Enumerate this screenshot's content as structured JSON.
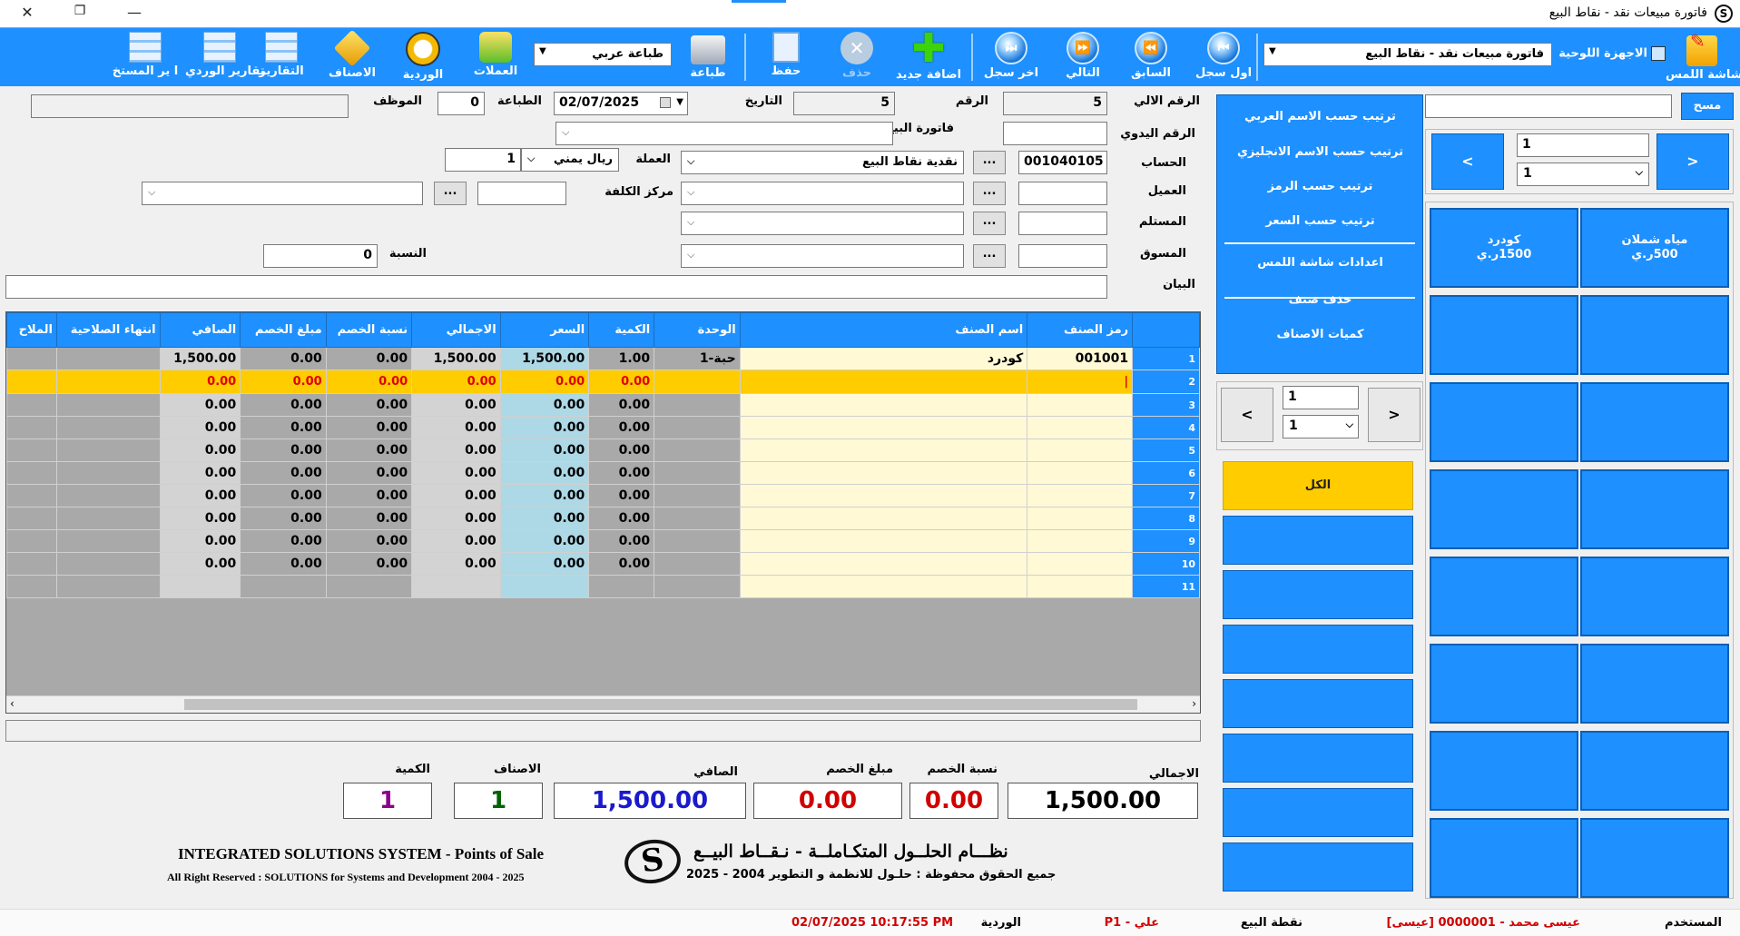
{
  "window": {
    "title": "فاتورة مبيعات نقد - نقاط البيع"
  },
  "toolbar": {
    "buttons": [
      {
        "label": "شاشة اللمس",
        "icon": "touch-screen-icon"
      },
      {
        "label": "اول سجل",
        "icon": "first-record-icon"
      },
      {
        "label": "السابق",
        "icon": "previous-icon"
      },
      {
        "label": "التالي",
        "icon": "next-icon"
      },
      {
        "label": "اخر سجل",
        "icon": "last-record-icon"
      },
      {
        "label": "اضافة جديد",
        "icon": "add-icon"
      },
      {
        "label": "حذف",
        "icon": "delete-icon"
      },
      {
        "label": "حفظ",
        "icon": "save-icon"
      },
      {
        "label": "طباعة",
        "icon": "print-icon"
      },
      {
        "label": "العملات",
        "icon": "currencies-icon"
      },
      {
        "label": "الوردية",
        "icon": "shift-icon"
      },
      {
        "label": "الاصناف",
        "icon": "items-icon"
      },
      {
        "label": "التقارير",
        "icon": "reports-icon"
      },
      {
        "label": "تقارير الوردي",
        "icon": "shift-reports-icon"
      },
      {
        "label": "ا ير المستخ",
        "icon": "user-reports-icon"
      }
    ],
    "tablet_label": "الاجهزة اللوحية",
    "invoice_type": "فاتورة مبيعات نقد - نقاط البيع",
    "print_mode": "طباعة عربي"
  },
  "header": {
    "auto_number_label": "الرقم الالي",
    "auto_number": "5",
    "number_label": "الرقم",
    "number": "5",
    "date_label": "التاريخ",
    "date": "02/07/2025",
    "print_label": "الطباعة",
    "print_count": "0",
    "employee_label": "الموظف",
    "employee": "",
    "manual_number_label": "الرقم اليدوي",
    "manual_number": "",
    "sales_invoice_label": "فاتورة البيع",
    "account_label": "الحساب",
    "account_code": "001040105",
    "account_name": "نقدية نقاط البيع",
    "currency_label": "العملة",
    "currency": "ريال يمني",
    "currency_rate": "1",
    "customer_label": "العميل",
    "cost_center_label": "مركز الكلفة",
    "receiver_label": "المستلم",
    "marketer_label": "المسوق",
    "ratio_label": "النسبة",
    "ratio": "0",
    "statement_label": "البيان",
    "dots": "..."
  },
  "grid": {
    "columns": [
      "رمز الصنف",
      "اسم الصنف",
      "الوحدة",
      "الكمية",
      "السعر",
      "الاجمالي",
      "نسبة الخصم",
      "مبلغ الخصم",
      "الصافي",
      "انتهاء الصلاحية",
      "الملاح"
    ],
    "rows": [
      {
        "n": "1",
        "code": "001001",
        "name": "كودرد",
        "unit": "1-حبة",
        "qty": "1.00",
        "price": "1,500.00",
        "total": "1,500.00",
        "dpct": "0.00",
        "damt": "0.00",
        "net": "1,500.00"
      },
      {
        "n": "2",
        "code": "|",
        "name": "",
        "unit": "",
        "qty": "0.00",
        "price": "0.00",
        "total": "0.00",
        "dpct": "0.00",
        "damt": "0.00",
        "net": "0.00"
      },
      {
        "n": "3",
        "code": "",
        "name": "",
        "unit": "",
        "qty": "0.00",
        "price": "0.00",
        "total": "0.00",
        "dpct": "0.00",
        "damt": "0.00",
        "net": "0.00"
      },
      {
        "n": "4",
        "code": "",
        "name": "",
        "unit": "",
        "qty": "0.00",
        "price": "0.00",
        "total": "0.00",
        "dpct": "0.00",
        "damt": "0.00",
        "net": "0.00"
      },
      {
        "n": "5",
        "code": "",
        "name": "",
        "unit": "",
        "qty": "0.00",
        "price": "0.00",
        "total": "0.00",
        "dpct": "0.00",
        "damt": "0.00",
        "net": "0.00"
      },
      {
        "n": "6",
        "code": "",
        "name": "",
        "unit": "",
        "qty": "0.00",
        "price": "0.00",
        "total": "0.00",
        "dpct": "0.00",
        "damt": "0.00",
        "net": "0.00"
      },
      {
        "n": "7",
        "code": "",
        "name": "",
        "unit": "",
        "qty": "0.00",
        "price": "0.00",
        "total": "0.00",
        "dpct": "0.00",
        "damt": "0.00",
        "net": "0.00"
      },
      {
        "n": "8",
        "code": "",
        "name": "",
        "unit": "",
        "qty": "0.00",
        "price": "0.00",
        "total": "0.00",
        "dpct": "0.00",
        "damt": "0.00",
        "net": "0.00"
      },
      {
        "n": "9",
        "code": "",
        "name": "",
        "unit": "",
        "qty": "0.00",
        "price": "0.00",
        "total": "0.00",
        "dpct": "0.00",
        "damt": "0.00",
        "net": "0.00"
      },
      {
        "n": "10",
        "code": "",
        "name": "",
        "unit": "",
        "qty": "0.00",
        "price": "0.00",
        "total": "0.00",
        "dpct": "0.00",
        "damt": "0.00",
        "net": "0.00"
      },
      {
        "n": "11",
        "code": "",
        "name": "",
        "unit": "",
        "qty": "",
        "price": "",
        "total": "",
        "dpct": "",
        "damt": "",
        "net": ""
      }
    ],
    "selected_row": 1
  },
  "totals": {
    "total_label": "الاجمالي",
    "total": "1,500.00",
    "disc_pct_label": "نسبة الخصم",
    "disc_pct": "0.00",
    "disc_amt_label": "مبلغ الخصم",
    "disc_amt": "0.00",
    "net_label": "الصافي",
    "net": "1,500.00",
    "items_label": "الاصناف",
    "items": "1",
    "qty_label": "الكمية",
    "qty": "1"
  },
  "branding": {
    "ar_title": "نظـــام الحلــول المتكـاملــة - نـقــاط البيــع",
    "ar_copy": "جميع الحقوق محفوظة : حلـول للانظمة و التطوير 2004 - 2025",
    "en_title": "INTEGRATED SOLUTIONS SYSTEM - Points of Sale",
    "en_copy": "All Right Reserved : SOLUTIONS for Systems and Development 2004 - 2025"
  },
  "side": {
    "sort_menu": [
      "ترتيب حسب الاسم العربي",
      "ترتيب حسب الاسم الانجليزي",
      "ترتيب حسب الرمز",
      "ترتيب حسب السعر",
      "اعدادات شاشة اللمس",
      "حذف صنف",
      "كميات الاصناف"
    ],
    "group_page": "1",
    "group_page_sel": "1",
    "all_label": "الكل",
    "lt": "<",
    "gt": ">"
  },
  "touch": {
    "clear_label": "مسح",
    "search": "",
    "page": "1",
    "page_sel": "1",
    "tiles": [
      {
        "name": "مياه شملان",
        "price": "500ر.ي"
      },
      {
        "name": "كودرد",
        "price": "1500ر.ي"
      }
    ]
  },
  "status": {
    "user_label": "المستخدم",
    "user": "عيسى محمد - 0000001 [عيسى]",
    "pos_label": "نقطة البيع",
    "pos": "علي - P1",
    "shift_label": "الوردية",
    "shift": "02/07/2025 10:17:55 PM"
  },
  "colors": {
    "accent": "#1e90ff",
    "highlight": "#ffcc00",
    "error": "#e00000",
    "net": "#1a1acc",
    "qty": "#8b008b",
    "items": "#006400"
  }
}
